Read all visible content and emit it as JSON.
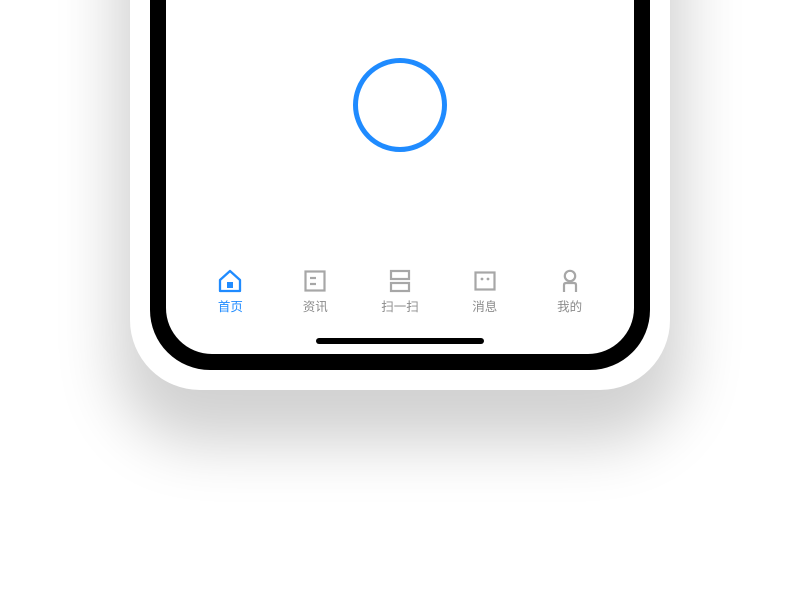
{
  "colors": {
    "accent": "#1f8bff",
    "inactive": "#a7a7a7",
    "text_inactive": "#8c8c8c"
  },
  "tabs": [
    {
      "key": "home",
      "icon": "home-icon",
      "label": "首页",
      "active": true
    },
    {
      "key": "news",
      "icon": "news-icon",
      "label": "资讯",
      "active": false
    },
    {
      "key": "scan",
      "icon": "scan-icon",
      "label": "扫一扫",
      "active": false
    },
    {
      "key": "message",
      "icon": "message-icon",
      "label": "消息",
      "active": false
    },
    {
      "key": "mine",
      "icon": "mine-icon",
      "label": "我的",
      "active": false
    }
  ]
}
